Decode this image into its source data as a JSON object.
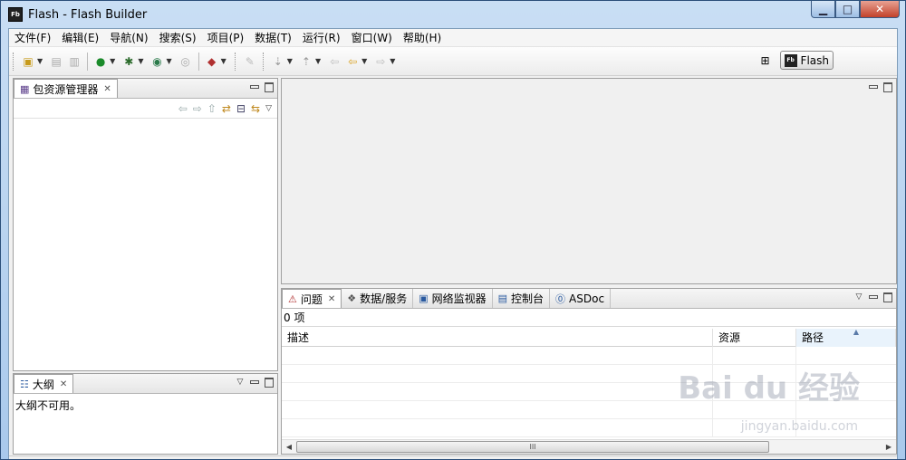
{
  "window": {
    "title": "Flash  -  Flash Builder",
    "app_icon": "Fb"
  },
  "menu": [
    "文件(F)",
    "编辑(E)",
    "导航(N)",
    "搜索(S)",
    "项目(P)",
    "数据(T)",
    "运行(R)",
    "窗口(W)",
    "帮助(H)"
  ],
  "toolbar": {
    "perspective_label": "Flash",
    "perspective_icon": "Fb"
  },
  "package_explorer": {
    "tab_label": "包资源管理器"
  },
  "outline": {
    "tab_label": "大纲",
    "message": "大纲不可用。"
  },
  "problems": {
    "tabs": [
      {
        "label": "问题",
        "active": true
      },
      {
        "label": "数据/服务",
        "active": false
      },
      {
        "label": "网络监视器",
        "active": false
      },
      {
        "label": "控制台",
        "active": false
      },
      {
        "label": "ASDoc",
        "active": false
      }
    ],
    "count": "0 项",
    "columns": [
      "描述",
      "资源",
      "路径"
    ],
    "scroll_thumb": "III"
  },
  "watermark": {
    "brand": "Bai du 经验",
    "url": "jingyan.baidu.com"
  }
}
